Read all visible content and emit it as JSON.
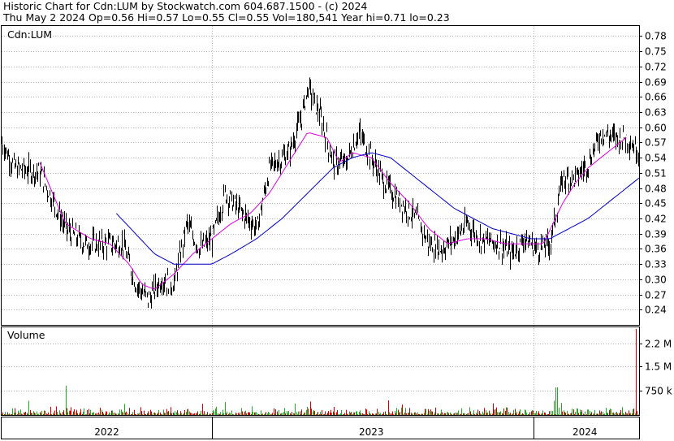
{
  "header": {
    "line1": "Historic Chart for Cdn:LUM by Stockwatch.com 604.687.1500 - (c) 2024",
    "line2": "Thu May  2 2024  Op=0.56  Hi=0.57  Lo=0.55  Cl=0.55  Vol=180,541  Year hi=0.71  lo=0.23"
  },
  "chart_data": {
    "type": "line",
    "symbol_label": "Cdn:LUM",
    "volume_label": "Volume",
    "x_tick_labels": [
      "2022",
      "2023",
      "2024"
    ],
    "price_ticks": [
      "0.78",
      "0.75",
      "0.72",
      "0.69",
      "0.66",
      "0.63",
      "0.60",
      "0.57",
      "0.54",
      "0.51",
      "0.48",
      "0.45",
      "0.42",
      "0.39",
      "0.36",
      "0.33",
      "0.30",
      "0.27",
      "0.24"
    ],
    "volume_ticks": [
      "2.2 M",
      "1.5 M",
      "750 k"
    ],
    "ylim": [
      0.21,
      0.8
    ],
    "volume_ylim": [
      0,
      2700000
    ],
    "colors": {
      "price_bar": "#000000",
      "ma_short": "#dd00dd",
      "ma_long": "#0000cc",
      "vol_up": "#22aa22",
      "vol_down": "#cc0000",
      "grid": "#b4b4b4"
    },
    "price_anchors": [
      [
        0.0,
        0.57
      ],
      [
        0.02,
        0.52
      ],
      [
        0.06,
        0.51
      ],
      [
        0.1,
        0.4
      ],
      [
        0.13,
        0.37
      ],
      [
        0.16,
        0.37
      ],
      [
        0.19,
        0.37
      ],
      [
        0.21,
        0.29
      ],
      [
        0.23,
        0.26
      ],
      [
        0.25,
        0.3
      ],
      [
        0.27,
        0.29
      ],
      [
        0.29,
        0.41
      ],
      [
        0.31,
        0.36
      ],
      [
        0.33,
        0.38
      ],
      [
        0.35,
        0.47
      ],
      [
        0.37,
        0.44
      ],
      [
        0.4,
        0.4
      ],
      [
        0.42,
        0.52
      ],
      [
        0.45,
        0.55
      ],
      [
        0.47,
        0.62
      ],
      [
        0.48,
        0.68
      ],
      [
        0.5,
        0.62
      ],
      [
        0.52,
        0.53
      ],
      [
        0.54,
        0.53
      ],
      [
        0.56,
        0.59
      ],
      [
        0.58,
        0.54
      ],
      [
        0.6,
        0.49
      ],
      [
        0.62,
        0.46
      ],
      [
        0.65,
        0.42
      ],
      [
        0.67,
        0.37
      ],
      [
        0.69,
        0.36
      ],
      [
        0.71,
        0.38
      ],
      [
        0.73,
        0.41
      ],
      [
        0.75,
        0.38
      ],
      [
        0.78,
        0.37
      ],
      [
        0.8,
        0.35
      ],
      [
        0.82,
        0.38
      ],
      [
        0.84,
        0.36
      ],
      [
        0.86,
        0.37
      ],
      [
        0.88,
        0.5
      ],
      [
        0.9,
        0.5
      ],
      [
        0.92,
        0.53
      ],
      [
        0.94,
        0.59
      ],
      [
        0.96,
        0.58
      ],
      [
        0.98,
        0.58
      ],
      [
        1.0,
        0.55
      ]
    ],
    "ma_short_anchors": [
      [
        0.06,
        0.53
      ],
      [
        0.1,
        0.41
      ],
      [
        0.14,
        0.38
      ],
      [
        0.17,
        0.37
      ],
      [
        0.2,
        0.33
      ],
      [
        0.22,
        0.29
      ],
      [
        0.24,
        0.28
      ],
      [
        0.27,
        0.31
      ],
      [
        0.3,
        0.35
      ],
      [
        0.33,
        0.38
      ],
      [
        0.36,
        0.41
      ],
      [
        0.39,
        0.43
      ],
      [
        0.42,
        0.47
      ],
      [
        0.45,
        0.53
      ],
      [
        0.48,
        0.59
      ],
      [
        0.51,
        0.58
      ],
      [
        0.53,
        0.53
      ],
      [
        0.55,
        0.55
      ],
      [
        0.58,
        0.54
      ],
      [
        0.61,
        0.49
      ],
      [
        0.64,
        0.45
      ],
      [
        0.67,
        0.4
      ],
      [
        0.7,
        0.37
      ],
      [
        0.73,
        0.38
      ],
      [
        0.76,
        0.38
      ],
      [
        0.79,
        0.37
      ],
      [
        0.82,
        0.37
      ],
      [
        0.85,
        0.37
      ],
      [
        0.88,
        0.45
      ],
      [
        0.9,
        0.49
      ],
      [
        0.92,
        0.52
      ],
      [
        0.95,
        0.55
      ],
      [
        0.98,
        0.58
      ]
    ],
    "ma_long_anchors": [
      [
        0.18,
        0.43
      ],
      [
        0.21,
        0.39
      ],
      [
        0.24,
        0.35
      ],
      [
        0.27,
        0.33
      ],
      [
        0.3,
        0.33
      ],
      [
        0.33,
        0.33
      ],
      [
        0.36,
        0.35
      ],
      [
        0.4,
        0.38
      ],
      [
        0.44,
        0.42
      ],
      [
        0.48,
        0.47
      ],
      [
        0.52,
        0.52
      ],
      [
        0.55,
        0.54
      ],
      [
        0.58,
        0.55
      ],
      [
        0.61,
        0.54
      ],
      [
        0.64,
        0.51
      ],
      [
        0.68,
        0.47
      ],
      [
        0.71,
        0.44
      ],
      [
        0.74,
        0.42
      ],
      [
        0.77,
        0.4
      ],
      [
        0.8,
        0.39
      ],
      [
        0.83,
        0.38
      ],
      [
        0.86,
        0.38
      ],
      [
        0.89,
        0.4
      ],
      [
        0.92,
        0.42
      ],
      [
        0.95,
        0.45
      ],
      [
        0.98,
        0.48
      ],
      [
        1.0,
        0.5
      ]
    ],
    "volume_spikes": [
      [
        0.1,
        900000
      ],
      [
        0.35,
        400000
      ],
      [
        0.46,
        350000
      ],
      [
        0.87,
        850000
      ],
      [
        0.995,
        2650000
      ]
    ]
  }
}
